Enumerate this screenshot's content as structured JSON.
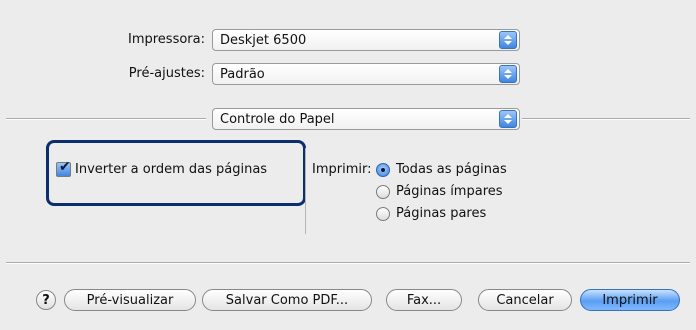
{
  "printer": {
    "label": "Impressora:",
    "value": "Deskjet 6500"
  },
  "presets": {
    "label": "Pré-ajustes:",
    "value": "Padrão"
  },
  "panel": {
    "value": "Controle do Papel"
  },
  "reverse_order": {
    "label": "Inverter a ordem das páginas",
    "checked": true
  },
  "print_range": {
    "label": "Imprimir:",
    "options": [
      "Todas as páginas",
      "Páginas ímpares",
      "Páginas pares"
    ],
    "selected": "Todas as páginas"
  },
  "buttons": {
    "help": "?",
    "preview": "Pré-visualizar",
    "save_pdf": "Salvar Como PDF...",
    "fax": "Fax...",
    "cancel": "Cancelar",
    "print": "Imprimir"
  },
  "colors": {
    "highlight": "#0c2e6e",
    "accent": "#3f86e2"
  }
}
